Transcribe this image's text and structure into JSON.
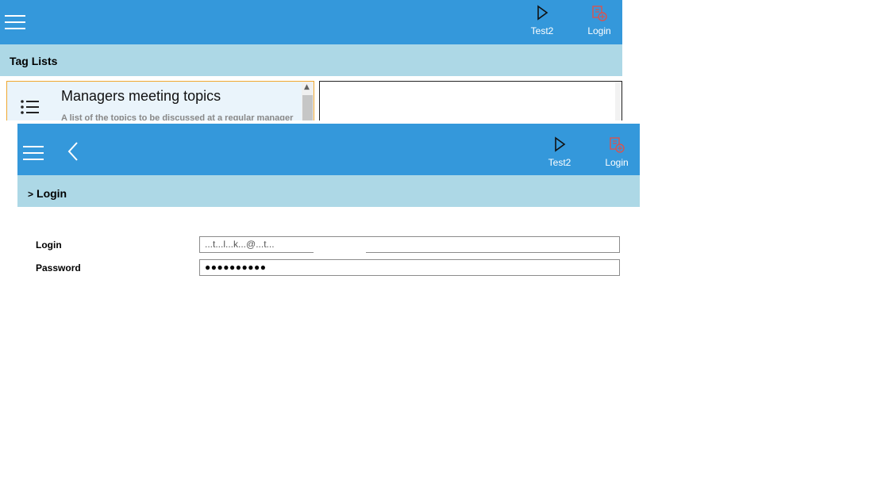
{
  "back_window": {
    "toolbar": {
      "test2_label": "Test2",
      "login_label": "Login"
    },
    "subheader": {
      "title": "Tag Lists"
    },
    "list": {
      "items": [
        {
          "title": "Managers meeting topics",
          "description": "A list of the topics to be discussed at a regular manager"
        }
      ]
    }
  },
  "front_window": {
    "toolbar": {
      "test2_label": "Test2",
      "login_label": "Login"
    },
    "breadcrumb": {
      "separator": ">",
      "current": "Login"
    },
    "form": {
      "login_label": "Login",
      "login_value": "...t...l...k...@...t...",
      "password_label": "Password",
      "password_value": "●●●●●●●●●●"
    }
  },
  "colors": {
    "toolbar_bg": "#3498db",
    "subheader_bg": "#add8e6",
    "login_icon": "#d9534f",
    "selection_border": "#f0a830"
  },
  "icons": [
    "menu-icon",
    "back-arrow-icon",
    "play-icon",
    "login-icon",
    "list-icon"
  ]
}
